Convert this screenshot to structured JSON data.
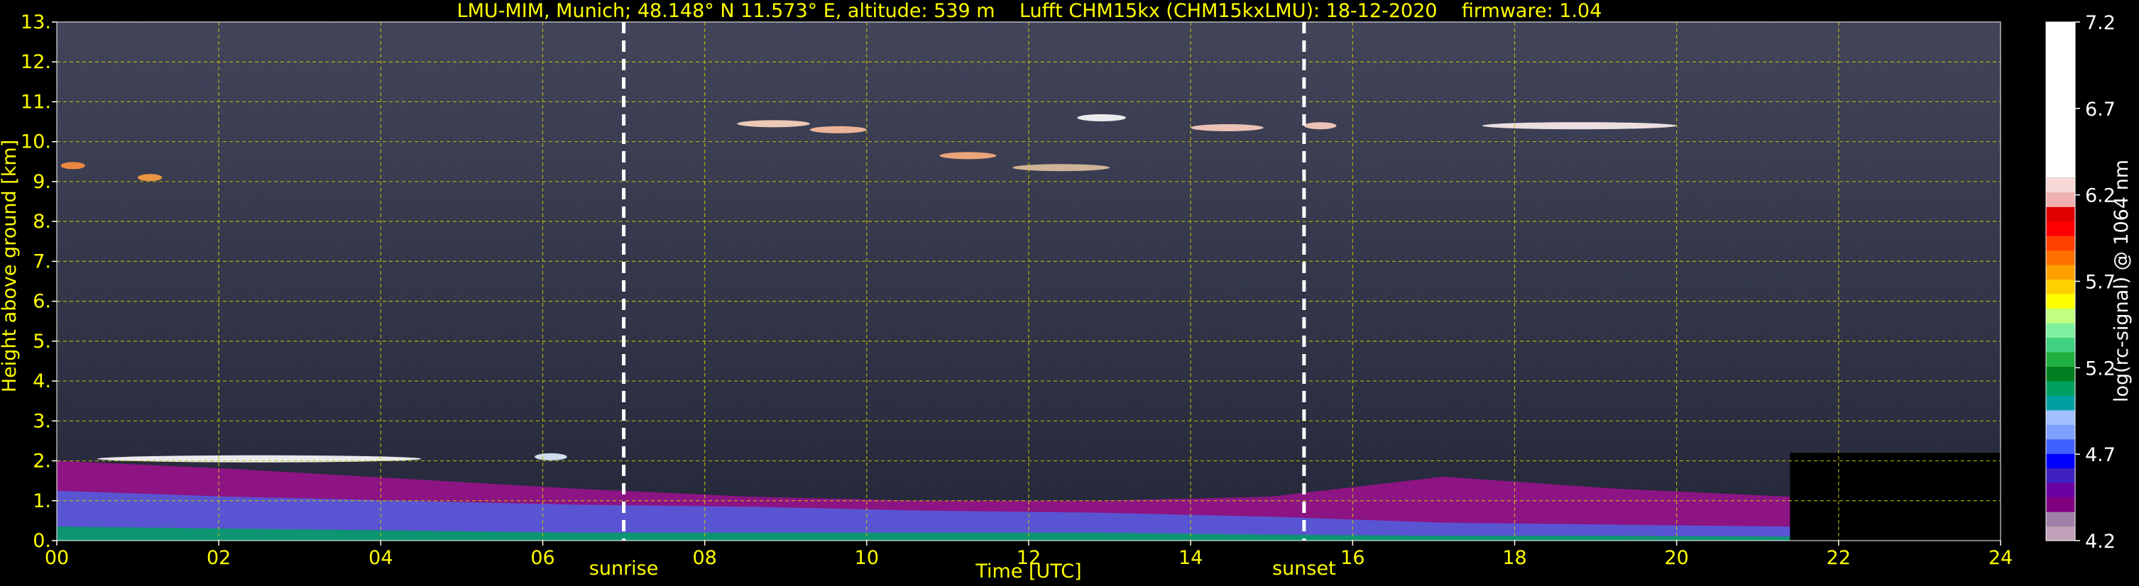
{
  "chart_data": {
    "type": "heatmap",
    "title": "LMU-MIM, Munich; 48.148° N 11.573° E, altitude: 539 m    Lufft CHM15kx (CHM15kxLMU): 18-12-2020    firmware: 1.04",
    "xlabel": "Time [UTC]",
    "ylabel": "Height above ground [km]",
    "xlim": [
      0,
      24
    ],
    "ylim": [
      0,
      13
    ],
    "x_ticks": [
      "00",
      "02",
      "04",
      "06",
      "08",
      "10",
      "12",
      "14",
      "16",
      "18",
      "20",
      "22",
      "24"
    ],
    "y_ticks": [
      "0.",
      "1.",
      "2.",
      "3.",
      "4.",
      "5.",
      "6.",
      "7.",
      "8.",
      "9.",
      "10.",
      "11.",
      "12.",
      "13."
    ],
    "grid": true,
    "events": [
      {
        "label": "sunrise",
        "time": 7.0
      },
      {
        "label": "sunset",
        "time": 15.4
      }
    ],
    "colorbar": {
      "label": "log(rc-signal) @ 1064 nm",
      "range": [
        4.2,
        7.2
      ],
      "ticks": [
        "4.2",
        "4.7",
        "5.2",
        "5.7",
        "6.2",
        "6.7",
        "7.2"
      ],
      "colors": [
        "#c0a0b8",
        "#a080a8",
        "#800080",
        "#6a00a0",
        "#4020c0",
        "#0000ff",
        "#4060ff",
        "#80a0ff",
        "#a0c0ff",
        "#00a0a0",
        "#00a060",
        "#008020",
        "#20b040",
        "#40d080",
        "#80f0a0",
        "#c0ff80",
        "#ffff00",
        "#ffd000",
        "#ffa000",
        "#ff7000",
        "#ff4000",
        "#ff0000",
        "#e00000",
        "#f0b0b0",
        "#f8d8d8",
        "#ffffff"
      ]
    },
    "layers": [
      {
        "name": "boundary-layer-magenta",
        "start": 0,
        "end": 21.4,
        "top": [
          2.0,
          1.8,
          1.55,
          1.3,
          1.1,
          1.0,
          1.0,
          1.1,
          1.6,
          1.3,
          1.1
        ],
        "color": "#a01090"
      },
      {
        "name": "residual-layer-blue",
        "start": 0,
        "end": 21.4,
        "top": [
          1.25,
          1.1,
          1.0,
          0.9,
          0.85,
          0.75,
          0.7,
          0.6,
          0.45,
          0.4,
          0.35
        ],
        "color": "#5060e0"
      },
      {
        "name": "surface-layer-green",
        "start": 0,
        "end": 21.4,
        "top": [
          0.35,
          0.3,
          0.25,
          0.2,
          0.2,
          0.2,
          0.2,
          0.15,
          0.12,
          0.12,
          0.1
        ],
        "color": "#00a060"
      }
    ],
    "clouds": [
      {
        "t0": 0.05,
        "t1": 0.35,
        "h": 9.4,
        "color": "#ff9040"
      },
      {
        "t0": 1.0,
        "t1": 1.3,
        "h": 9.1,
        "color": "#ffa040"
      },
      {
        "t0": 0.5,
        "t1": 4.5,
        "h": 2.05,
        "color": "#ffffff"
      },
      {
        "t0": 5.9,
        "t1": 6.3,
        "h": 2.1,
        "color": "#e0f0ff"
      },
      {
        "t0": 8.4,
        "t1": 9.3,
        "h": 10.45,
        "color": "#ffd8c0"
      },
      {
        "t0": 9.3,
        "t1": 10.0,
        "h": 10.3,
        "color": "#ffc0a0"
      },
      {
        "t0": 10.9,
        "t1": 11.6,
        "h": 9.65,
        "color": "#ffb080"
      },
      {
        "t0": 11.8,
        "t1": 13.0,
        "h": 9.35,
        "color": "#e0c0a0"
      },
      {
        "t0": 12.6,
        "t1": 13.2,
        "h": 10.6,
        "color": "#ffffff"
      },
      {
        "t0": 14.0,
        "t1": 14.9,
        "h": 10.35,
        "color": "#ffd0c0"
      },
      {
        "t0": 15.4,
        "t1": 15.8,
        "h": 10.4,
        "color": "#ffd0c0"
      },
      {
        "t0": 17.6,
        "t1": 20.0,
        "h": 10.4,
        "color": "#fff0f0"
      }
    ]
  }
}
